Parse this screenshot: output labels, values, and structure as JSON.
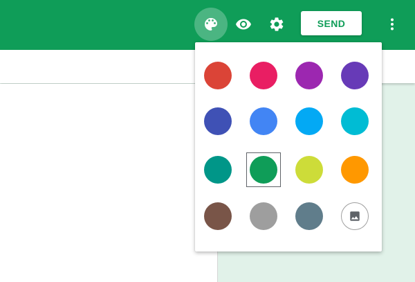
{
  "header": {
    "color": "#0f9d58",
    "icons": [
      "palette-icon",
      "eye-icon",
      "gear-icon",
      "more-vert-icon"
    ],
    "send_label": "SEND"
  },
  "theme_picker": {
    "swatches": [
      {
        "name": "red",
        "color": "#db4437"
      },
      {
        "name": "pink",
        "color": "#e91e63"
      },
      {
        "name": "purple",
        "color": "#9c27b0"
      },
      {
        "name": "deep-purple",
        "color": "#673ab7"
      },
      {
        "name": "indigo",
        "color": "#3f51b5"
      },
      {
        "name": "blue",
        "color": "#4285f4"
      },
      {
        "name": "light-blue",
        "color": "#03a9f4"
      },
      {
        "name": "cyan",
        "color": "#00bcd4"
      },
      {
        "name": "teal",
        "color": "#009688"
      },
      {
        "name": "green",
        "color": "#0f9d58"
      },
      {
        "name": "lime",
        "color": "#cddc39"
      },
      {
        "name": "orange",
        "color": "#ff9800"
      },
      {
        "name": "brown",
        "color": "#795548"
      },
      {
        "name": "grey",
        "color": "#9e9e9e"
      },
      {
        "name": "blue-grey",
        "color": "#607d8b"
      }
    ],
    "selected": "green",
    "custom_image_icon": "image-icon"
  },
  "background_tint": "#e1f2e9"
}
